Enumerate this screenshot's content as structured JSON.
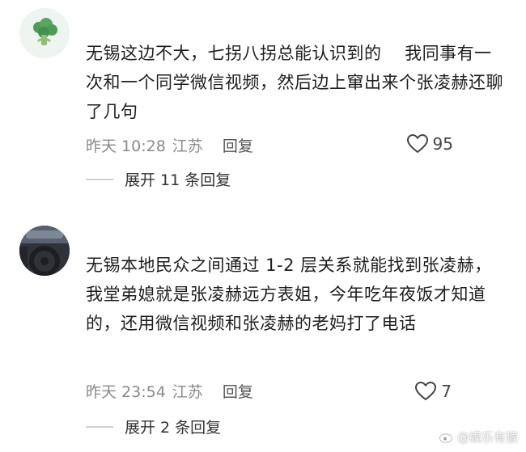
{
  "comments": [
    {
      "text": "无锡这边不大，七拐八拐总能认识到的　 我同事有一次和一个同学微信视频，然后边上窜出来个张凌赫还聊了几句",
      "time": "昨天 10:28",
      "location": "江苏",
      "reply_label": "回复",
      "likes": "95",
      "expand_label": "展开 11 条回复"
    },
    {
      "text": "无锡本地民众之间通过 1-2 层关系就能找到张凌赫，我堂弟媳就是张凌赫远方表姐，今年吃年夜饭才知道的，还用微信视频和张凌赫的老妈打了电话",
      "time": "昨天 23:54",
      "location": "江苏",
      "reply_label": "回复",
      "likes": "7",
      "expand_label": "展开 2 条回复"
    }
  ],
  "watermark": "@娱乐有猴",
  "icons": {
    "avatar1": "broccoli-avatar",
    "avatar2": "car-interior-avatar",
    "like": "heart-outline-icon"
  },
  "colors": {
    "meta_text": "#8a8a8a",
    "body_text": "#1e1e1e",
    "broccoli": "#4f9a58"
  }
}
